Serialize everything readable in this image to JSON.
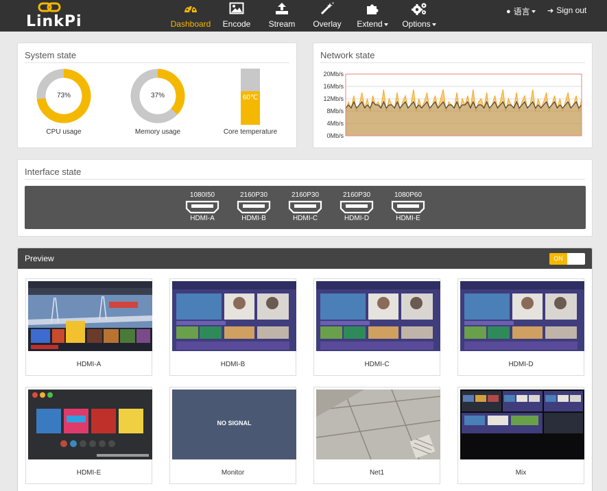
{
  "brand": {
    "name": "LinkPi",
    "accent": "#f5b800"
  },
  "nav": {
    "items": [
      {
        "label": "Dashboard",
        "icon": "dashboard-icon",
        "active": true
      },
      {
        "label": "Encode",
        "icon": "image-icon"
      },
      {
        "label": "Stream",
        "icon": "upload-icon"
      },
      {
        "label": "Overlay",
        "icon": "magic-wand-icon"
      },
      {
        "label": "Extend",
        "icon": "puzzle-icon",
        "dropdown": true
      },
      {
        "label": "Options",
        "icon": "gears-icon",
        "dropdown": true
      }
    ],
    "language": "语言",
    "signout": "Sign out"
  },
  "system": {
    "title": "System state",
    "cpu": {
      "value": "73%",
      "percent": 73,
      "label": "CPU usage"
    },
    "memory": {
      "value": "37%",
      "percent": 37,
      "label": "Memory usage"
    },
    "temperature": {
      "value": "60℃",
      "percent": 60,
      "label": "Core temperature"
    }
  },
  "network": {
    "title": "Network state"
  },
  "chart_data": {
    "type": "area",
    "title": "",
    "xlabel": "",
    "ylabel": "",
    "y_ticks": [
      "20Mb/s",
      "16Mb/s",
      "12Mb/s",
      "8Mb/s",
      "4Mb/s",
      "0Mb/s"
    ],
    "ylim": [
      0,
      20
    ],
    "grid": true,
    "series": [
      {
        "color": "#f5a623",
        "values": [
          8,
          11,
          9,
          13,
          8,
          10,
          14,
          9,
          12,
          8,
          13,
          10,
          11,
          9,
          15,
          8,
          12,
          10,
          9,
          14,
          8,
          11,
          13,
          9,
          10,
          15,
          8,
          12,
          9,
          11,
          14,
          8,
          10,
          13,
          9,
          12,
          15,
          8,
          11,
          10,
          9,
          14,
          8,
          12,
          10,
          13,
          9,
          15,
          8,
          11,
          12,
          9,
          14,
          8,
          10,
          13,
          9,
          11,
          15,
          8,
          12,
          10,
          9,
          14,
          8,
          11,
          13,
          9,
          10,
          15,
          8,
          12,
          9,
          11,
          14,
          8,
          10,
          13,
          9,
          12,
          8,
          11,
          14,
          9,
          10,
          13,
          8,
          12
        ]
      },
      {
        "color": "#444444",
        "values": [
          9,
          10,
          9,
          11,
          9,
          10,
          11,
          9,
          10,
          9,
          11,
          10,
          10,
          9,
          11,
          9,
          10,
          10,
          9,
          11,
          9,
          10,
          11,
          9,
          10,
          11,
          9,
          10,
          9,
          10,
          11,
          9,
          10,
          11,
          9,
          10,
          11,
          9,
          10,
          10,
          9,
          11,
          9,
          10,
          10,
          11,
          9,
          11,
          9,
          10,
          10,
          9,
          11,
          9,
          10,
          11,
          9,
          10,
          11,
          9,
          10,
          10,
          9,
          11,
          9,
          10,
          11,
          9,
          10,
          11,
          9,
          10,
          9,
          10,
          11,
          9,
          10,
          11,
          9,
          10,
          9,
          10,
          11,
          9,
          10,
          11,
          9,
          10
        ]
      }
    ]
  },
  "interface": {
    "title": "Interface state",
    "ports": [
      {
        "res": "1080I50",
        "name": "HDMI-A"
      },
      {
        "res": "2160P30",
        "name": "HDMI-B"
      },
      {
        "res": "2160P30",
        "name": "HDMI-C"
      },
      {
        "res": "2160P30",
        "name": "HDMI-D"
      },
      {
        "res": "1080P60",
        "name": "HDMI-E"
      }
    ]
  },
  "preview": {
    "title": "Preview",
    "toggle": "ON",
    "tiles": [
      {
        "label": "HDMI-A",
        "kind": "bridge"
      },
      {
        "label": "HDMI-B",
        "kind": "purple"
      },
      {
        "label": "HDMI-C",
        "kind": "purple"
      },
      {
        "label": "HDMI-D",
        "kind": "purple"
      },
      {
        "label": "HDMI-E",
        "kind": "game"
      },
      {
        "label": "Monitor",
        "kind": "nosignal",
        "overlay": "NO SIGNAL"
      },
      {
        "label": "Net1",
        "kind": "ceiling"
      },
      {
        "label": "Mix",
        "kind": "mix"
      }
    ]
  }
}
